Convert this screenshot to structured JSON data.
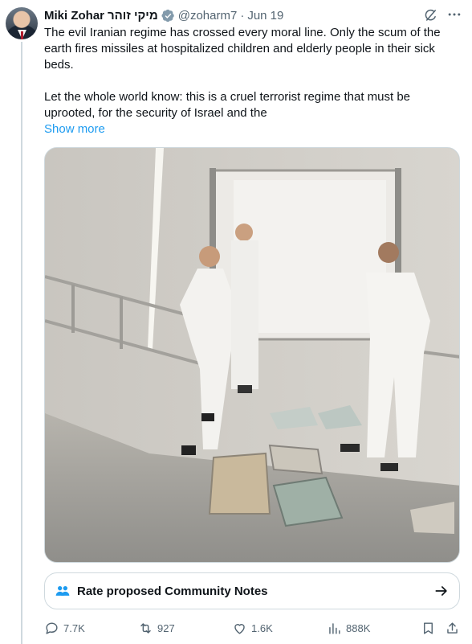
{
  "author": {
    "name": "Miki Zohar",
    "hebrew_name": "מיקי זוהר",
    "handle": "@zoharm7",
    "date": "Jun 19"
  },
  "tweet": {
    "paragraphs": [
      "The evil Iranian regime has crossed every moral line. Only the scum of the earth fires missiles at hospitalized children and elderly people in their sick beds.",
      "Let the whole world know: this is a cruel terrorist regime that must be uprooted, for the security of Israel and the"
    ],
    "show_more": "Show more"
  },
  "community_notes": {
    "label": "Rate proposed Community Notes"
  },
  "actions": {
    "replies": "7.7K",
    "reposts": "927",
    "likes": "1.6K",
    "views": "888K"
  },
  "colors": {
    "accent": "#1d9bf0",
    "secondary_text": "#536471",
    "border": "#cfd9de"
  },
  "icons": [
    "verified-badge-icon",
    "grok-icon",
    "more-options-icon",
    "people-icon",
    "arrow-right-icon",
    "reply-icon",
    "repost-icon",
    "like-icon",
    "views-icon",
    "bookmark-icon",
    "share-icon"
  ]
}
